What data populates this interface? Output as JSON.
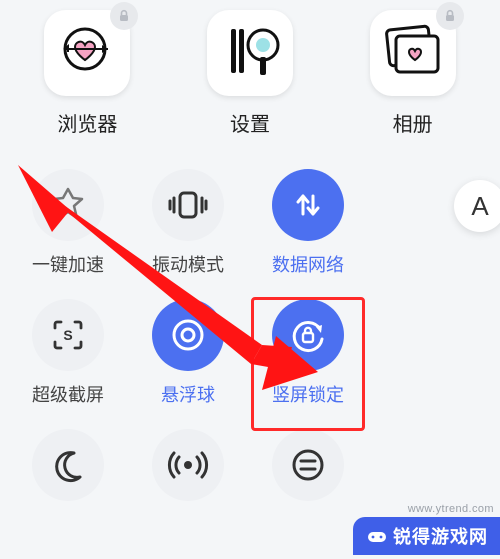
{
  "apps": [
    {
      "label": "浏览器",
      "icon": "heart-target-icon",
      "locked": true
    },
    {
      "label": "设置",
      "icon": "cutlery-icon",
      "locked": false
    },
    {
      "label": "相册",
      "icon": "photo-stack-icon",
      "locked": true
    }
  ],
  "font_pill": "A",
  "qs": {
    "row1": [
      {
        "label": "一键加速",
        "icon": "boost-icon",
        "active": false
      },
      {
        "label": "振动模式",
        "icon": "vibrate-icon",
        "active": false
      },
      {
        "label": "数据网络",
        "icon": "data-icon",
        "active": true
      }
    ],
    "row2": [
      {
        "label": "超级截屏",
        "icon": "screenshot-icon",
        "active": false
      },
      {
        "label": "悬浮球",
        "icon": "float-icon",
        "active": true
      },
      {
        "label": "竖屏锁定",
        "icon": "rotation-lock-icon",
        "active": true,
        "highlight": true
      }
    ],
    "row3": [
      {
        "label": "",
        "icon": "moon-icon",
        "active": false
      },
      {
        "label": "",
        "icon": "hotspot-icon",
        "active": false
      },
      {
        "label": "",
        "icon": "menu-circle-icon",
        "active": false
      }
    ]
  },
  "watermark": {
    "brand": "锐得游戏网",
    "url": "www.ytrend.com"
  }
}
